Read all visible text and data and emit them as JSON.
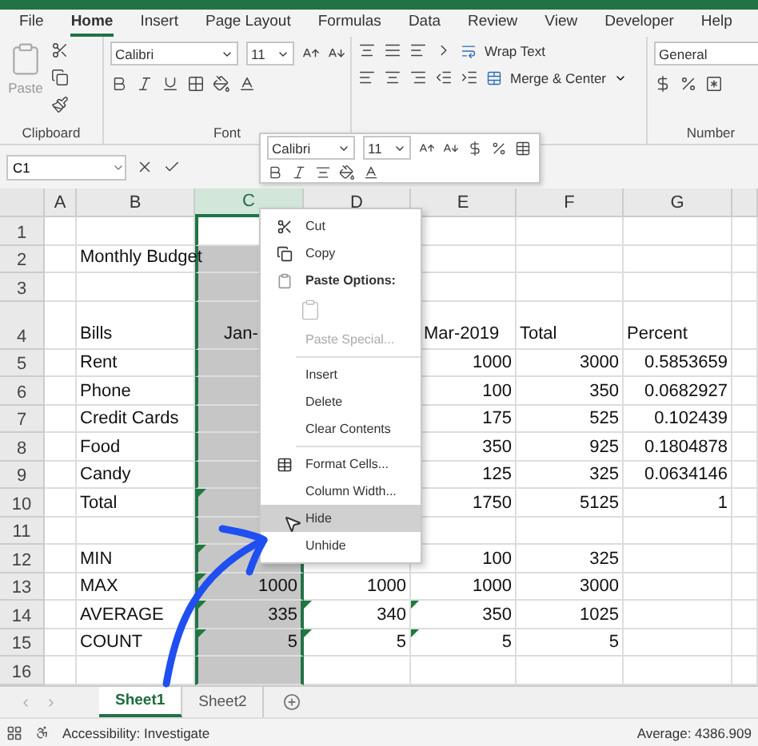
{
  "ribbon_tabs": [
    {
      "label": "File",
      "selected": false
    },
    {
      "label": "Home",
      "selected": true
    },
    {
      "label": "Insert",
      "selected": false
    },
    {
      "label": "Page Layout",
      "selected": false
    },
    {
      "label": "Formulas",
      "selected": false
    },
    {
      "label": "Data",
      "selected": false
    },
    {
      "label": "Review",
      "selected": false
    },
    {
      "label": "View",
      "selected": false
    },
    {
      "label": "Developer",
      "selected": false
    },
    {
      "label": "Help",
      "selected": false
    }
  ],
  "ribbon": {
    "clipboard": {
      "paste": "Paste",
      "label": "Clipboard"
    },
    "font": {
      "name": "Calibri",
      "size": "11",
      "label": "Font"
    },
    "alignment": {
      "wrap": "Wrap Text",
      "merge": "Merge & Center"
    },
    "number": {
      "format": "General",
      "label": "Number"
    }
  },
  "name_box": "C1",
  "mini_toolbar": {
    "font": "Calibri",
    "size": "11"
  },
  "columns": [
    {
      "label": "A",
      "selected": false
    },
    {
      "label": "B",
      "selected": false
    },
    {
      "label": "C",
      "selected": true
    },
    {
      "label": "D",
      "selected": false
    },
    {
      "label": "E",
      "selected": false
    },
    {
      "label": "F",
      "selected": false
    },
    {
      "label": "G",
      "selected": false
    }
  ],
  "rows": [
    {
      "header": "1",
      "kind": "blank",
      "cells": {}
    },
    {
      "header": "2",
      "kind": "labels",
      "cells": {
        "b": "Monthly Budget"
      }
    },
    {
      "header": "3",
      "kind": "blank",
      "cells": {}
    },
    {
      "header": "4",
      "kind": "labels",
      "cells": {
        "b": "Bills",
        "c": "Jan-",
        "e": "Mar-2019",
        "f": "Total",
        "g": "Percent"
      }
    },
    {
      "header": "5",
      "kind": "numbers",
      "cells": {
        "b": "Rent",
        "e": "1000",
        "f": "3000",
        "g": "0.5853659"
      }
    },
    {
      "header": "6",
      "kind": "numbers",
      "cells": {
        "b": "Phone",
        "e": "100",
        "f": "350",
        "g": "0.0682927"
      }
    },
    {
      "header": "7",
      "kind": "numbers",
      "cells": {
        "b": "Credit Cards",
        "e": "175",
        "f": "525",
        "g": "0.102439"
      }
    },
    {
      "header": "8",
      "kind": "numbers",
      "cells": {
        "b": "Food",
        "e": "350",
        "f": "925",
        "g": "0.1804878"
      }
    },
    {
      "header": "9",
      "kind": "numbers",
      "cells": {
        "b": "Candy",
        "e": "125",
        "f": "325",
        "g": "0.0634146"
      }
    },
    {
      "header": "10",
      "kind": "numbers",
      "cells": {
        "b": "Total",
        "e": "1750",
        "f": "5125",
        "g": "1"
      },
      "flags": {
        "c": true
      }
    },
    {
      "header": "11",
      "kind": "blank",
      "cells": {}
    },
    {
      "header": "12",
      "kind": "numbers",
      "cells": {
        "b": "MIN",
        "e": "100",
        "f": "325"
      },
      "flags": {
        "c": true
      }
    },
    {
      "header": "13",
      "kind": "numbers",
      "cells": {
        "b": "MAX",
        "c": "1000",
        "d": "1000",
        "e": "1000",
        "f": "3000"
      },
      "flags": {
        "c": true
      }
    },
    {
      "header": "14",
      "kind": "numbers",
      "cells": {
        "b": "AVERAGE",
        "c": "335",
        "d": "340",
        "e": "350",
        "f": "1025"
      },
      "flags": {
        "c": true,
        "d": true,
        "e": true
      }
    },
    {
      "header": "15",
      "kind": "numbers",
      "cells": {
        "b": "COUNT",
        "c": "5",
        "d": "5",
        "e": "5",
        "f": "5"
      },
      "flags": {
        "c": true,
        "d": true,
        "e": true
      }
    },
    {
      "header": "16",
      "kind": "blank",
      "cells": {}
    }
  ],
  "context_menu": [
    {
      "kind": "item",
      "label": "Cut",
      "disabled": false,
      "selected": false
    },
    {
      "kind": "item",
      "label": "Copy",
      "disabled": false,
      "selected": false
    },
    {
      "kind": "heading",
      "label": "Paste Options:"
    },
    {
      "kind": "paste-icon"
    },
    {
      "kind": "item",
      "label": "Paste Special...",
      "disabled": true,
      "selected": false
    },
    {
      "kind": "separator"
    },
    {
      "kind": "item",
      "label": "Insert",
      "disabled": false,
      "selected": false
    },
    {
      "kind": "item",
      "label": "Delete",
      "disabled": false,
      "selected": false
    },
    {
      "kind": "item",
      "label": "Clear Contents",
      "disabled": false,
      "selected": false
    },
    {
      "kind": "separator"
    },
    {
      "kind": "item",
      "label": "Format Cells...",
      "disabled": false,
      "selected": false
    },
    {
      "kind": "item",
      "label": "Column Width...",
      "disabled": false,
      "selected": false
    },
    {
      "kind": "item",
      "label": "Hide",
      "disabled": false,
      "selected": true
    },
    {
      "kind": "item",
      "label": "Unhide",
      "disabled": false,
      "selected": false
    }
  ],
  "sheet_tabs": [
    {
      "label": "Sheet1",
      "selected": true
    },
    {
      "label": "Sheet2",
      "selected": false
    }
  ],
  "status_bar": {
    "accessibility": "Accessibility: Investigate",
    "average": "Average: 4386.909"
  }
}
